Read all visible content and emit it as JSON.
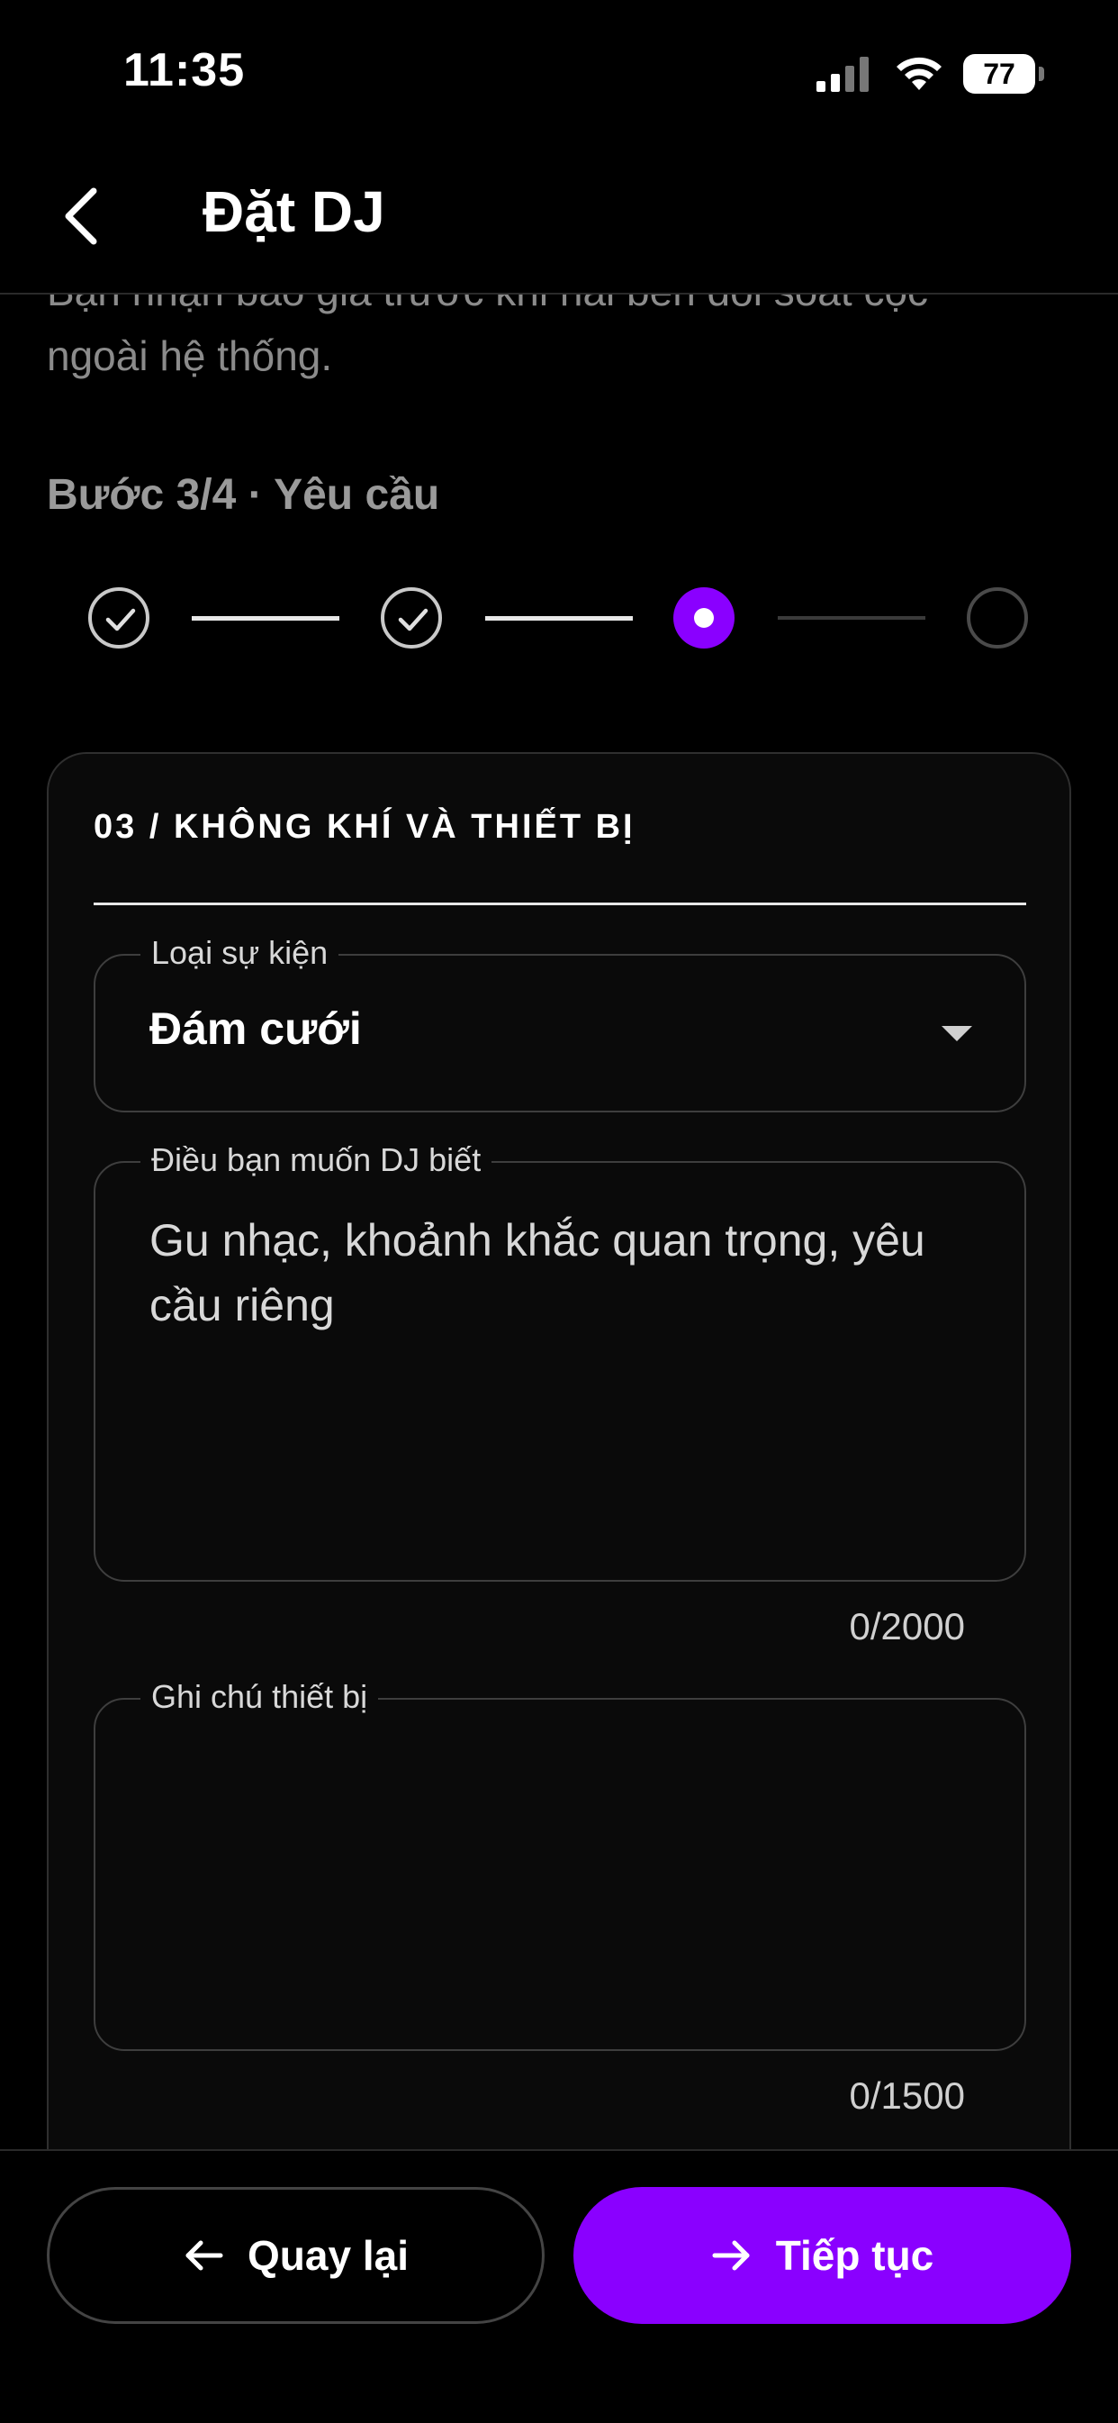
{
  "status_bar": {
    "time": "11:35",
    "battery": "77"
  },
  "header": {
    "title": "Đặt DJ"
  },
  "intro": {
    "line1": "Bạn nhận báo giá trước khi hai bên đối soát cọc",
    "line2": "ngoài hệ thống."
  },
  "step": {
    "title": "Bước 3/4 · Yêu cầu",
    "current": 3,
    "total": 4
  },
  "card": {
    "title": "03 / KHÔNG KHÍ VÀ THIẾT BỊ",
    "event_type": {
      "label": "Loại sự kiện",
      "value": "Đám cưới"
    },
    "dj_notes": {
      "label": "Điều bạn muốn DJ biết",
      "placeholder": "Gu nhạc, khoảnh khắc quan trọng, yêu cầu riêng",
      "counter": "0/2000"
    },
    "equipment_notes": {
      "label": "Ghi chú thiết bị",
      "counter": "0/1500"
    }
  },
  "actions": {
    "back_label": "Quay lại",
    "next_label": "Tiếp tục"
  },
  "colors": {
    "accent": "#8a00ff",
    "background": "#000000"
  }
}
